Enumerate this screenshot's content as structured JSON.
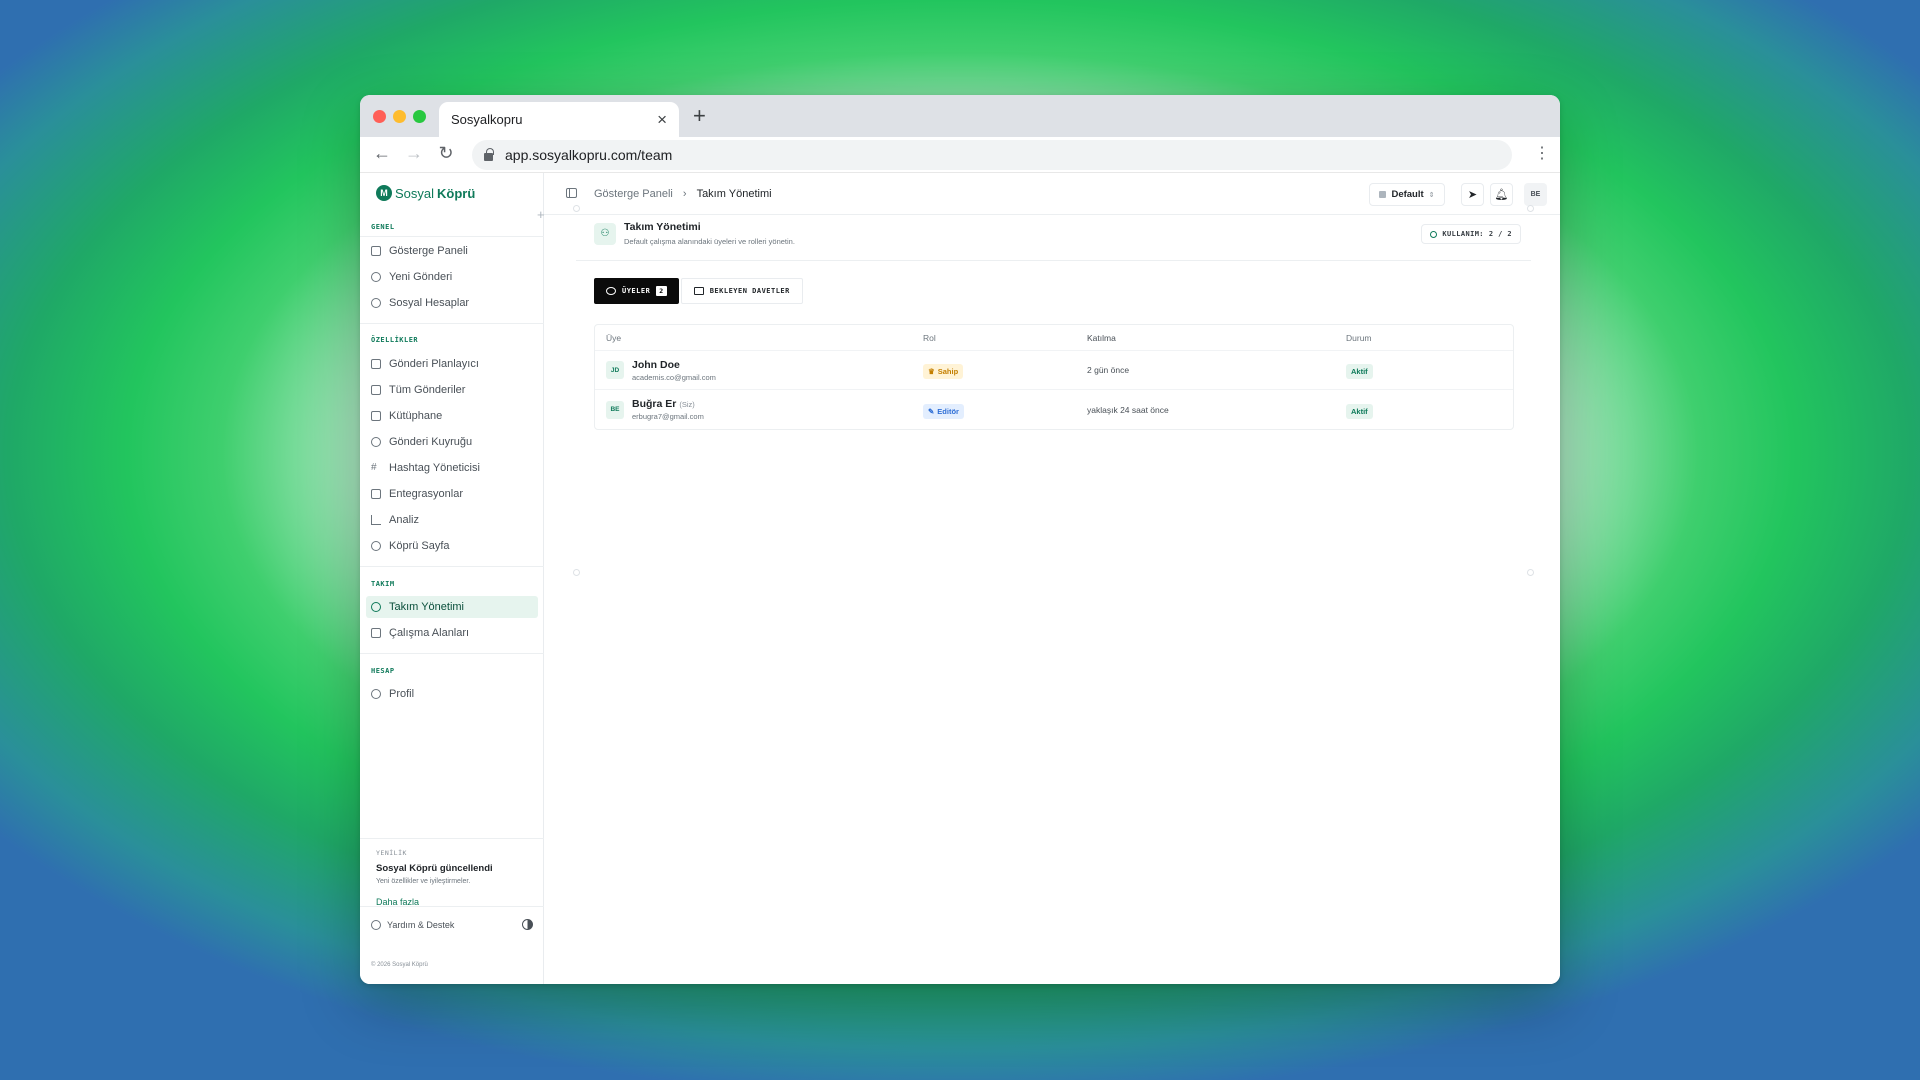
{
  "browser": {
    "tab_title": "Sosyalkopru",
    "tab_close": "×",
    "new_tab": "+",
    "url": "app.sosyalkopru.com/team"
  },
  "sidebar": {
    "logo_a": "Sosyal",
    "logo_b": "Köprü",
    "sections": {
      "general": "GENEL",
      "features": "ÖZELLİKLER",
      "team": "TAKIM",
      "account": "HESAP"
    },
    "items": {
      "dashboard": "Gösterge Paneli",
      "new_post": "Yeni Gönderi",
      "social_accounts": "Sosyal Hesaplar",
      "planner": "Gönderi Planlayıcı",
      "all_posts": "Tüm Gönderiler",
      "library": "Kütüphane",
      "queue": "Gönderi Kuyruğu",
      "hashtag": "Hashtag Yöneticisi",
      "integrations": "Entegrasyonlar",
      "analytics": "Analiz",
      "bridge_page": "Köprü Sayfa",
      "team_management": "Takım Yönetimi",
      "workspaces": "Çalışma Alanları",
      "profile": "Profil"
    },
    "news": {
      "tag": "YENİLİK",
      "title": "Sosyal Köprü güncellendi",
      "desc": "Yeni özellikler ve iyileştirmeler.",
      "more": "Daha fazla"
    },
    "help": "Yardım & Destek",
    "copyright": "© 2026 Sosyal Köprü"
  },
  "topbar": {
    "breadcrumb_root": "Gösterge Paneli",
    "breadcrumb_sep": "›",
    "breadcrumb_current": "Takım Yönetimi",
    "workspace": "Default",
    "user_initials": "BE"
  },
  "team": {
    "title": "Takım Yönetimi",
    "subtitle": "Default çalışma alanındaki üyeleri ve rolleri yönetin.",
    "usage_label": "KULLANIM:",
    "usage_value": "2 / 2",
    "tabs": {
      "members": "ÜYELER",
      "members_count": "2",
      "pending": "BEKLEYEN DAVETLER"
    },
    "columns": {
      "member": "Üye",
      "role": "Rol",
      "joined": "Katılma",
      "status": "Durum"
    },
    "rows": [
      {
        "initials": "JD",
        "name": "John Doe",
        "you": "",
        "email": "academis.co@gmail.com",
        "role": "Sahip",
        "joined": "2 gün önce",
        "status": "Aktif"
      },
      {
        "initials": "BE",
        "name": "Buğra Er",
        "you": "(Siz)",
        "email": "erbugra7@gmail.com",
        "role": "Editör",
        "joined": "yaklaşık 24 saat önce",
        "status": "Aktif"
      }
    ]
  },
  "colors": {
    "brand": "#0f7a5a",
    "owner_badge": "#c47f00",
    "editor_badge": "#2f6fd6"
  }
}
